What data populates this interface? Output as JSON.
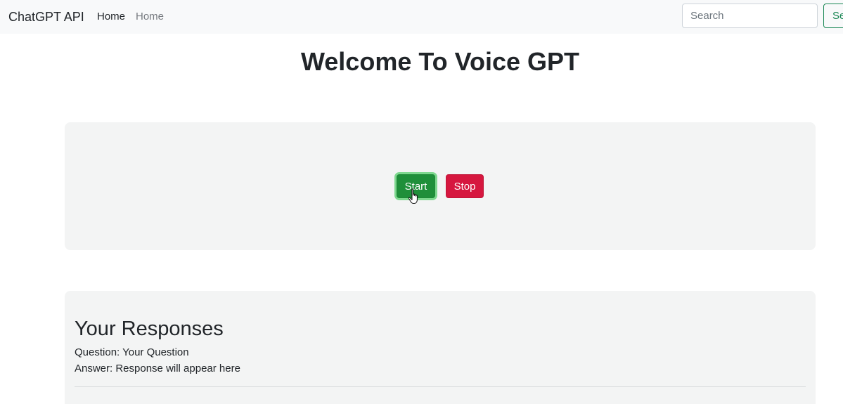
{
  "navbar": {
    "brand": "ChatGPT API",
    "links": [
      {
        "label": "Home",
        "active": true
      },
      {
        "label": "Home",
        "active": false
      }
    ],
    "search": {
      "placeholder": "Search",
      "button_label": "Search"
    }
  },
  "main": {
    "title": "Welcome To Voice GPT"
  },
  "controls": {
    "start_label": "Start",
    "stop_label": "Stop",
    "start_color": "#1f8f3a",
    "stop_color": "#d6173f"
  },
  "responses": {
    "title": "Your Responses",
    "question": "Question: Your Question",
    "answer": "Answer: Response will appear here"
  },
  "cursor_icon": "hand-pointer-icon"
}
